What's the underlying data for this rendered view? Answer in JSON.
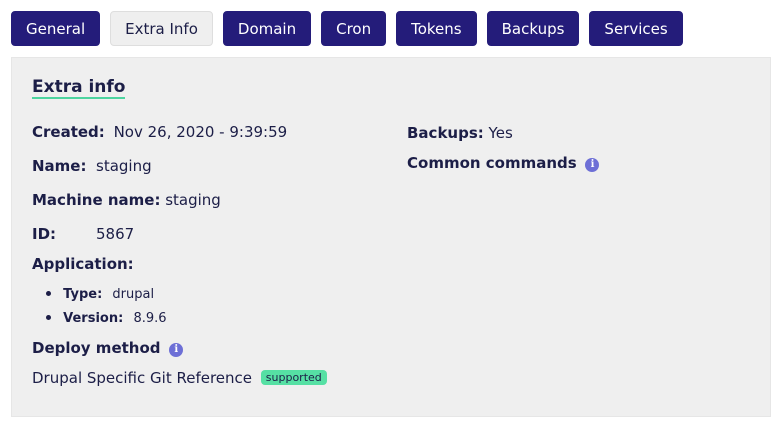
{
  "tabs": [
    "General",
    "Extra Info",
    "Domain",
    "Cron",
    "Tokens",
    "Backups",
    "Services"
  ],
  "active_tab": "Extra Info",
  "panel": {
    "title": "Extra info",
    "created": {
      "label": "Created:",
      "value": "Nov 26, 2020 - 9:39:59"
    },
    "name": {
      "label": "Name:",
      "value": "staging"
    },
    "machine_name": {
      "label": "Machine name:",
      "value": "staging"
    },
    "id": {
      "label": "ID:",
      "value": "5867"
    },
    "application": {
      "label": "Application:",
      "type": {
        "label": "Type:",
        "value": "drupal"
      },
      "version": {
        "label": "Version:",
        "value": "8.9.6"
      }
    },
    "deploy_method": {
      "label": "Deploy method",
      "value": "Drupal Specific Git Reference",
      "badge": "supported"
    },
    "backups": {
      "label": "Backups:",
      "value": "Yes"
    },
    "common_commands": {
      "label": "Common commands"
    }
  },
  "icons": {
    "info": "info-icon"
  },
  "colors": {
    "tab": "#241c7a",
    "accent": "#56e0a4",
    "info_icon": "#6d6fd6"
  }
}
